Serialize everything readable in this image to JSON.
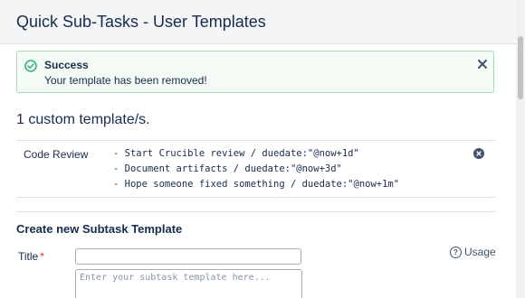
{
  "dialog": {
    "title": "Quick Sub-Tasks - User Templates"
  },
  "alert": {
    "title": "Success",
    "message": "Your template has been removed!",
    "color": "#36b37e"
  },
  "templates": {
    "count_text": "1 custom template/s.",
    "rows": [
      {
        "name": "Code Review",
        "lines": [
          "- Start Crucible review / duedate:\"@now+1d\"",
          "- Document artifacts / duedate:\"@now+3d\"",
          "- Hope someone fixed something / duedate:\"@now+1m\""
        ]
      }
    ]
  },
  "create": {
    "section_title": "Create new Subtask Template",
    "title_label": "Title",
    "required_marker": "*",
    "title_value": "",
    "body_placeholder": "Enter your subtask template here...",
    "usage_label": "Usage"
  }
}
